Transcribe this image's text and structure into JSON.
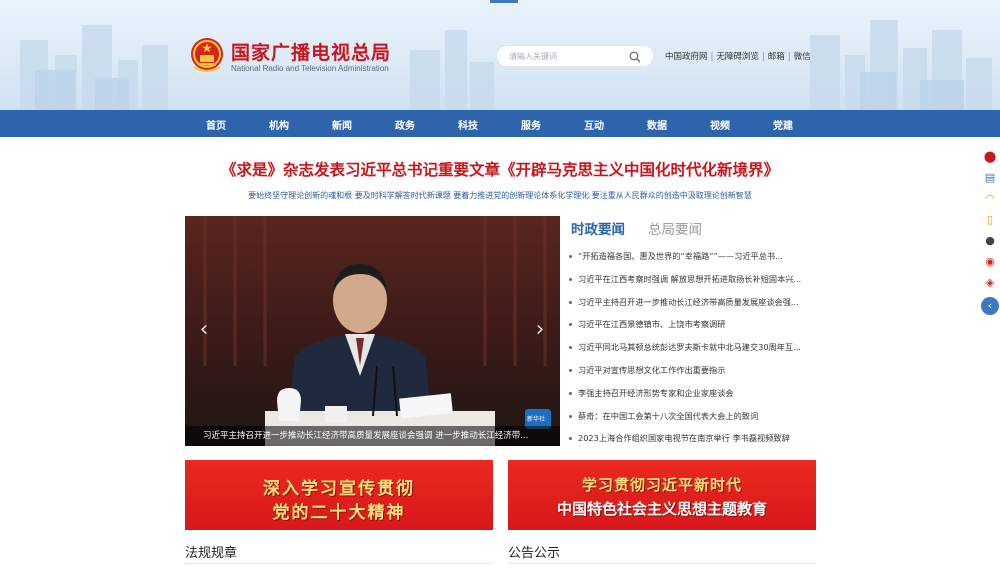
{
  "header": {
    "title": "国家广播电视总局",
    "subtitle": "National Radio and Television Administration",
    "search_placeholder": "请输入关键词",
    "links": [
      "中国政府网",
      "无障碍浏览",
      "邮箱",
      "微信"
    ]
  },
  "nav": [
    "首页",
    "机构",
    "新闻",
    "政务",
    "科技",
    "服务",
    "互动",
    "数据",
    "视频",
    "党建"
  ],
  "headline": {
    "title": "《求是》杂志发表习近平总书记重要文章《开辟马克思主义中国化时代化新境界》",
    "subtitle": "要始终坚守理论创新的魂和根 要及时科学解答时代新课题 要着力推进党的创新理论体系化学理化 要注重从人民群众的创造中汲取理论创新智慧"
  },
  "slider": {
    "caption": "习近平主持召开进一步推动长江经济带高质量发展座谈会强调 进一步推动长江经济带...",
    "watermark": "新华社"
  },
  "tabs": {
    "active": "时政要闻",
    "inactive": "总局要闻"
  },
  "news": [
    "“开拓造福各国、惠及世界的“幸福路””——习近平总书...",
    "习近平在江西考察时强调 解放思想开拓进取扬长补短固本兴...",
    "习近平主持召开进一步推动长江经济带高质量发展座谈会强...",
    "习近平在江西景德镇市、上饶市考察调研",
    "习近平同北马其顿总统彭达罗夫斯卡就中北马建交30周年互...",
    "习近平对宣传思想文化工作作出重要指示",
    "李强主持召开经济形势专家和企业家座谈会",
    "蔡奇：在中国工会第十八次全国代表大会上的致词",
    "2023上海合作组织国家电视节在南京举行 李书磊视频致辞"
  ],
  "banners": {
    "left": [
      "深入学习宣传贯彻",
      "党的二十大精神"
    ],
    "right": [
      "学习贯彻习近平新时代",
      "中国特色社会主义思想主题教育"
    ]
  },
  "sections": {
    "left": "法规规章",
    "right": "公告公示"
  },
  "colors": {
    "brand_red": "#c8161d",
    "nav_blue": "#2e64ab",
    "banner_red": "#e0201c",
    "banner_gold": "#ffe27a"
  }
}
